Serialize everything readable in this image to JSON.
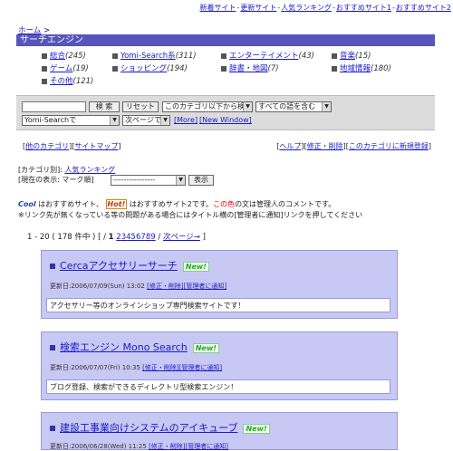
{
  "topnav": {
    "items": [
      "新着サイト",
      "更新サイト",
      "人気ランキング",
      "おすすめサイト1",
      "おすすめサイト2"
    ],
    "sep": "-"
  },
  "breadcrumb": {
    "home": "ホーム",
    "arrow": ">"
  },
  "category": {
    "title": "サーチエンジン"
  },
  "subcategories": [
    {
      "label": "総合",
      "count": "(245)"
    },
    {
      "label": "Yomi-Search系",
      "count": "(311)"
    },
    {
      "label": "エンターテイメント",
      "count": "(43)"
    },
    {
      "label": "音楽",
      "count": "(15)"
    },
    {
      "label": "ゲーム",
      "count": "(19)"
    },
    {
      "label": "ショッピング",
      "count": "(194)"
    },
    {
      "label": "辞書・地図",
      "count": "(7)"
    },
    {
      "label": "地域情報",
      "count": "(180)"
    },
    {
      "label": "その他",
      "count": "(121)"
    }
  ],
  "search": {
    "query": "",
    "search_button": "検 索",
    "reset_button": "リセット",
    "scope_select": "このカテゴリ以下から検索",
    "match_select": "すべての語を含む",
    "engine_select": "Yomi-Searchで",
    "next_select": "次ページで",
    "more_link": "[More]",
    "new_window_link": "[New Window]"
  },
  "links_left": {
    "other_cat": "他のカテゴリ",
    "sitemap": "サイトマップ"
  },
  "links_right": {
    "help": "ヘルプ",
    "edit": "修正・削除",
    "register": "このカテゴリに新規登録"
  },
  "sort": {
    "prefix": "[カテゴリ別]:",
    "ranking_link": "人気ランキング",
    "current_label": "[現在の表示: マーク順]",
    "select": "----------------",
    "show_button": "表示"
  },
  "notice": {
    "cool": "Cool",
    "text1": "はおすすめサイト、",
    "hot": "Hot!",
    "text2": "はおすすめサイト2です。",
    "colored": "この色",
    "text3": "の文は管理人のコメントです。",
    "line2a": "※リンク先が無くなっている等の問題がある場合にはタイトル横の",
    "line2b": "[管理者に通知]",
    "line2c": "リンクを押してください"
  },
  "pager": {
    "range": "1 - 20 ( 178 件中 )",
    "open": "[ / ",
    "current": "1",
    "pages": [
      "2",
      "3",
      "4",
      "5",
      "6",
      "7",
      "8",
      "9"
    ],
    "slash": "/",
    "next": "次ページ→",
    "close": "]"
  },
  "sites": [
    {
      "title": "Cercaアクセサリーサーチ",
      "badge": "New!",
      "updated": "更新日:2006/07/09(Sun) 13:02",
      "edit": "[修正・削除]",
      "notify": "[管理者に通知]",
      "desc": "アクセサリー等のオンラインショップ専門検索サイトです！"
    },
    {
      "title": "検索エンジン Mono Search",
      "badge": "New!",
      "updated": "更新日:2006/07/07(Fri) 10:35",
      "edit": "[修正・削除]",
      "notify": "[管理者に通知]",
      "desc": "ブログ登録、検索ができるディレクトリ型検索エンジン！"
    },
    {
      "title": "建設工事業向けシステムのアイキューブ",
      "badge": "New!",
      "updated": "更新日:2006/06/28(Wed) 11:25",
      "edit": "[修正・削除]",
      "notify": "[管理者に通知]",
      "desc": ""
    }
  ]
}
